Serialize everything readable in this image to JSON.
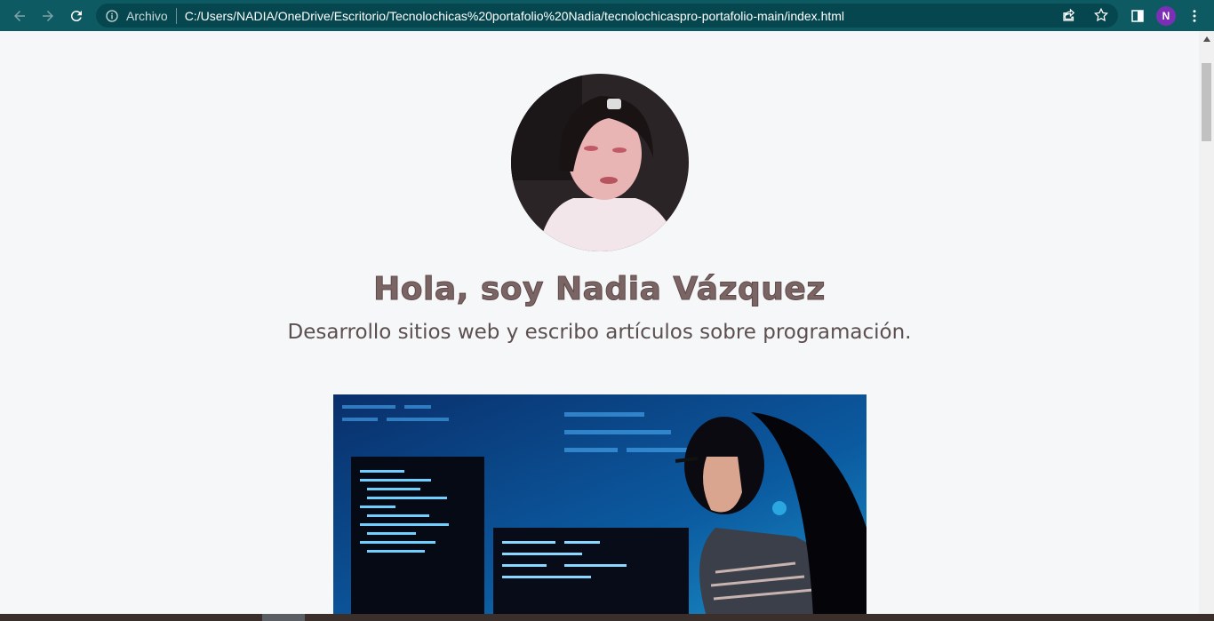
{
  "browser": {
    "address_label": "Archivo",
    "url": "C:/Users/NADIA/OneDrive/Escritorio/Tecnolochicas%20portafolio%20Nadia/tecnolochicaspro-portafolio-main/index.html",
    "profile_initial": "N",
    "colors": {
      "toolbar": "#0d5a63",
      "omnibox": "#06474f",
      "avatar": "#7b2fb5"
    },
    "icons": [
      "back-arrow-icon",
      "forward-arrow-icon",
      "reload-icon",
      "info-icon",
      "share-icon",
      "star-icon",
      "side-panel-icon",
      "more-vert-icon"
    ]
  },
  "page": {
    "headline": "Hola, soy Nadia Vázquez",
    "subheadline": "Desarrollo sitios web y escribo artículos sobre programación.",
    "colors": {
      "background": "#f6f7f9",
      "headline": "#7a6464",
      "subheadline": "#5c4f4f"
    }
  }
}
